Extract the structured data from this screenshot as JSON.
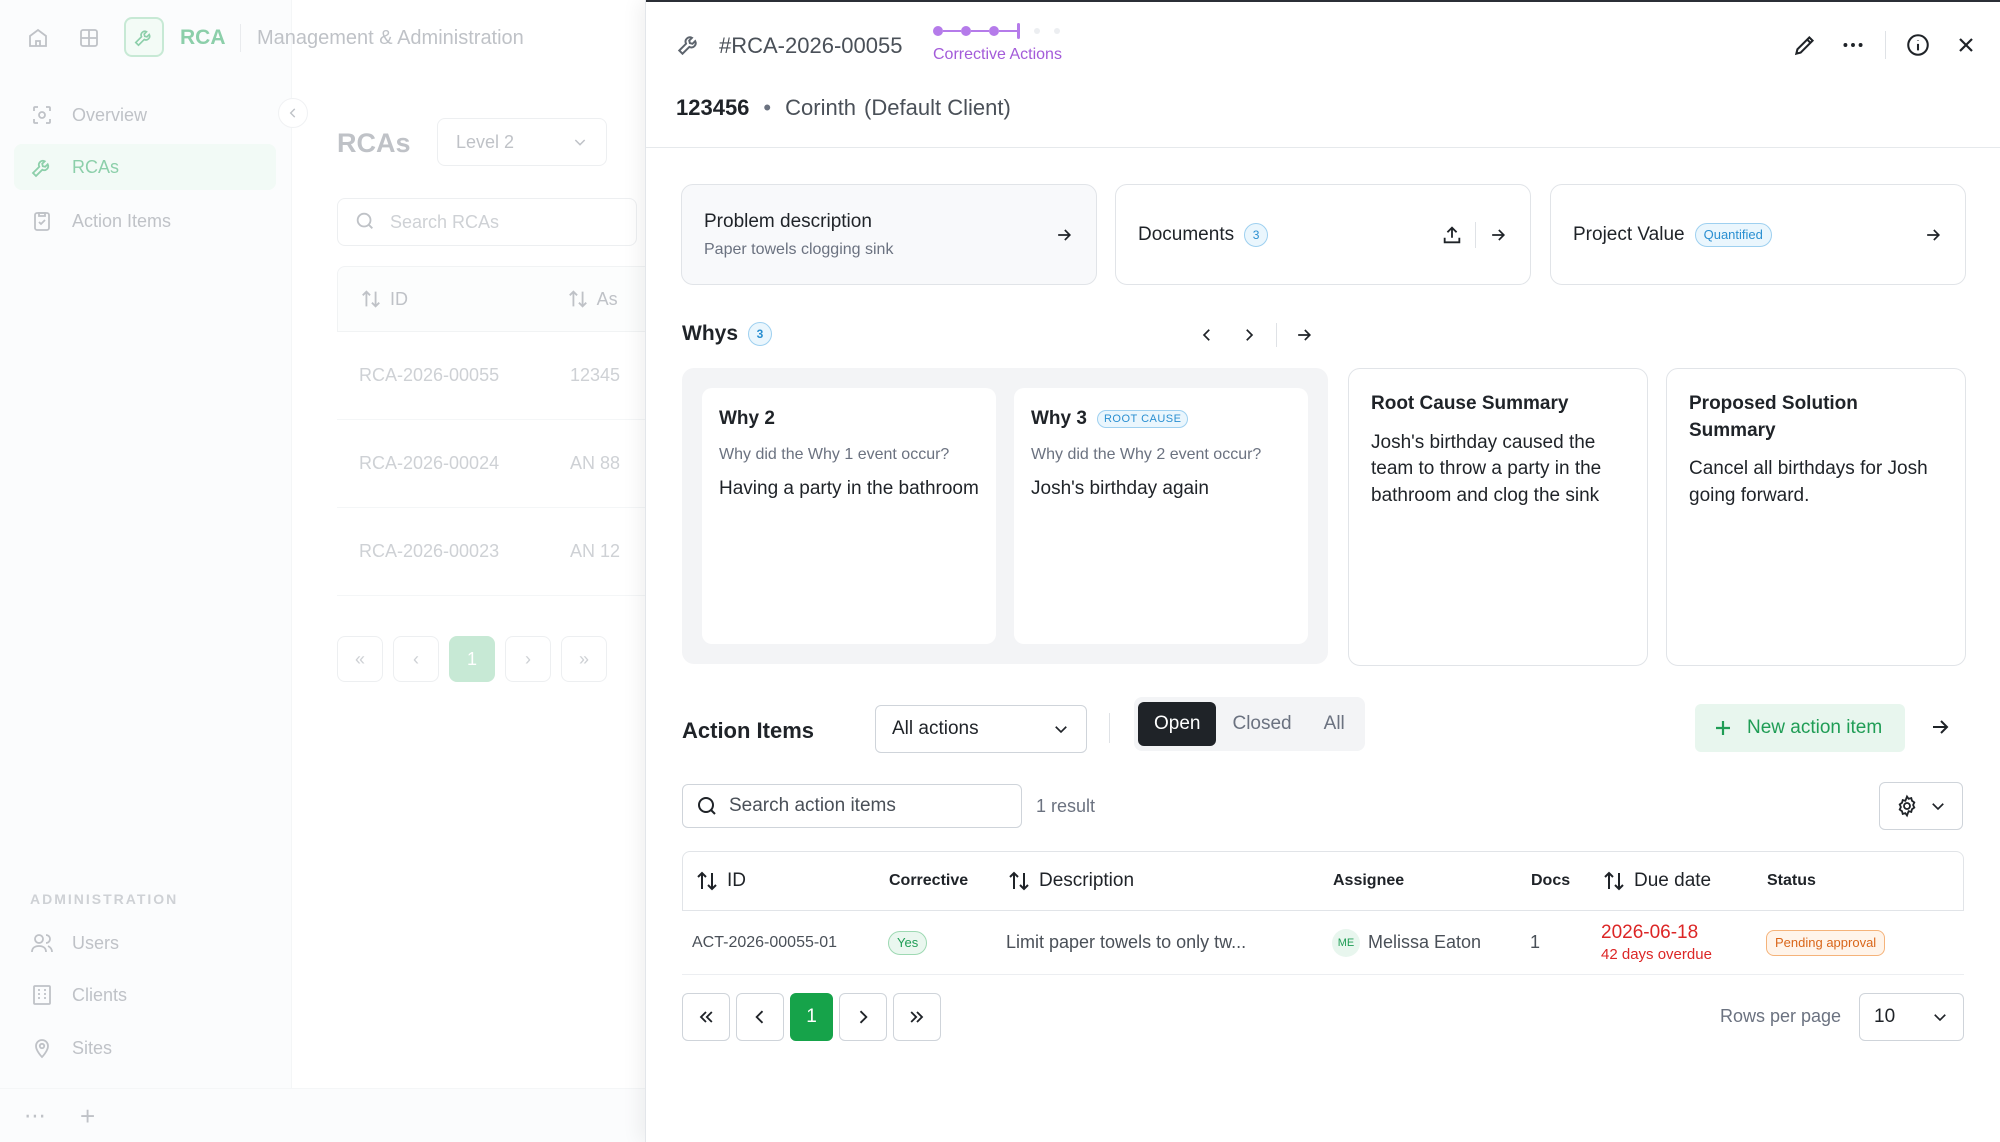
{
  "app": {
    "name": "RCA",
    "section": "Management & Administration"
  },
  "sidebar": {
    "items": [
      {
        "label": "Overview",
        "icon": "overview-icon"
      },
      {
        "label": "RCAs",
        "icon": "wrench-icon",
        "active": true
      },
      {
        "label": "Action Items",
        "icon": "clipboard-icon"
      }
    ],
    "admin_heading": "ADMINISTRATION",
    "admin_items": [
      {
        "label": "Users",
        "icon": "users-icon"
      },
      {
        "label": "Clients",
        "icon": "building-icon"
      },
      {
        "label": "Sites",
        "icon": "location-icon"
      }
    ]
  },
  "rca_list": {
    "title": "RCAs",
    "level": "Level 2",
    "search_placeholder": "Search RCAs",
    "columns": [
      "ID",
      "As"
    ],
    "rows": [
      {
        "id": "RCA-2026-00055",
        "col2": "12345"
      },
      {
        "id": "RCA-2026-00024",
        "col2": "AN 88"
      },
      {
        "id": "RCA-2026-00023",
        "col2": "AN 12"
      }
    ],
    "current_page": "1"
  },
  "panel": {
    "id": "#RCA-2026-00055",
    "stage_label": "Corrective Actions",
    "number": "123456",
    "site": "Corinth",
    "client": "(Default Client)",
    "problem": {
      "title": "Problem description",
      "text": "Paper towels clogging sink"
    },
    "documents": {
      "title": "Documents",
      "count": "3"
    },
    "project_value": {
      "title": "Project Value",
      "badge": "Quantified"
    },
    "whys": {
      "title": "Whys",
      "count": "3",
      "items": [
        {
          "title": "Why 2",
          "question": "Why did the Why 1 event occur?",
          "answer": "Having a party in the bathroom",
          "tag": ""
        },
        {
          "title": "Why 3",
          "question": "Why did the Why 2 event occur?",
          "answer": "Josh's birthday again",
          "tag": "ROOT CAUSE"
        }
      ]
    },
    "root_cause": {
      "title": "Root Cause Summary",
      "text": "Josh's birthday caused the team to throw a party in the bathroom and clog the sink"
    },
    "proposed_solution": {
      "title": "Proposed Solution Summary",
      "text": "Cancel all birthdays for Josh going forward."
    },
    "action_items": {
      "title": "Action Items",
      "filter": "All actions",
      "tabs": [
        "Open",
        "Closed",
        "All"
      ],
      "active_tab": "Open",
      "new_label": "New action item",
      "search_placeholder": "Search action items",
      "result_count": "1 result",
      "columns": {
        "id": "ID",
        "corrective": "Corrective",
        "description": "Description",
        "assignee": "Assignee",
        "docs": "Docs",
        "due": "Due date",
        "status": "Status"
      },
      "rows": [
        {
          "id": "ACT-2026-00055-01",
          "corrective": "Yes",
          "description": "Limit paper towels to only tw...",
          "assignee_initials": "ME",
          "assignee": "Melissa Eaton",
          "docs": "1",
          "due_date": "2026-06-18",
          "overdue": "42 days overdue",
          "status": "Pending approval"
        }
      ],
      "current_page": "1",
      "rows_per_page_label": "Rows per page",
      "rows_per_page": "10"
    }
  },
  "colors": {
    "brand_green": "#2fa865",
    "stage_purple": "#a35bd9",
    "info_blue": "#2a8fd1",
    "overdue_red": "#dc2626",
    "pending_orange": "#d9661a"
  }
}
